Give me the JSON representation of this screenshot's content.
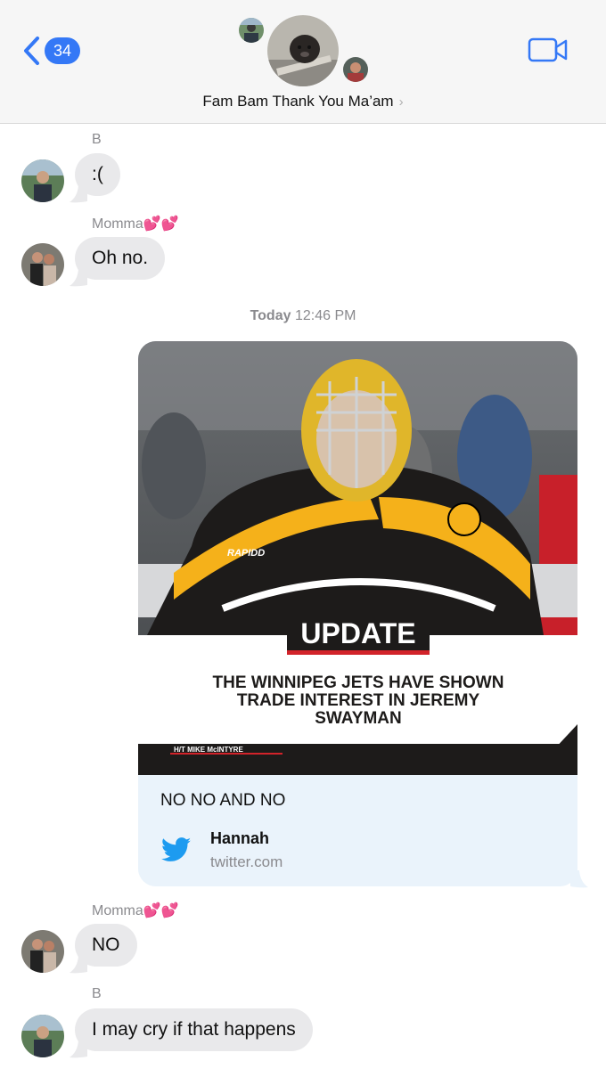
{
  "header": {
    "back_count": "34",
    "title": "Fam Bam Thank You Ma’am",
    "title_chevron": "›"
  },
  "messages": [
    {
      "sender": "B",
      "text": ":("
    },
    {
      "sender": "Momma💕💕",
      "text": "Oh no."
    },
    {
      "sender": "Momma💕💕",
      "text": "NO"
    },
    {
      "sender": "B",
      "text": "I may cry if that happens"
    }
  ],
  "timestamp": {
    "day": "Today",
    "time": "12:46 PM"
  },
  "link_card": {
    "image_jersey_text": "RAPIDD",
    "banner": "UPDATE",
    "headline_lines": [
      "THE WINNIPEG JETS HAVE SHOWN",
      "TRADE INTEREST IN JEREMY",
      "SWAYMAN"
    ],
    "credit": "H/T MIKE McINTYRE",
    "tweet_text": "NO NO AND NO",
    "author": "Hannah",
    "domain": "twitter.com"
  },
  "icons": {
    "back": "chevron-left-icon",
    "video": "video-camera-icon",
    "twitter": "twitter-bird-icon"
  },
  "colors": {
    "accent": "#3478f6",
    "bubble": "#e9e9eb",
    "card": "#eaf3fb",
    "twitter": "#1d9bf0",
    "bruins_gold": "#f5b11a"
  }
}
